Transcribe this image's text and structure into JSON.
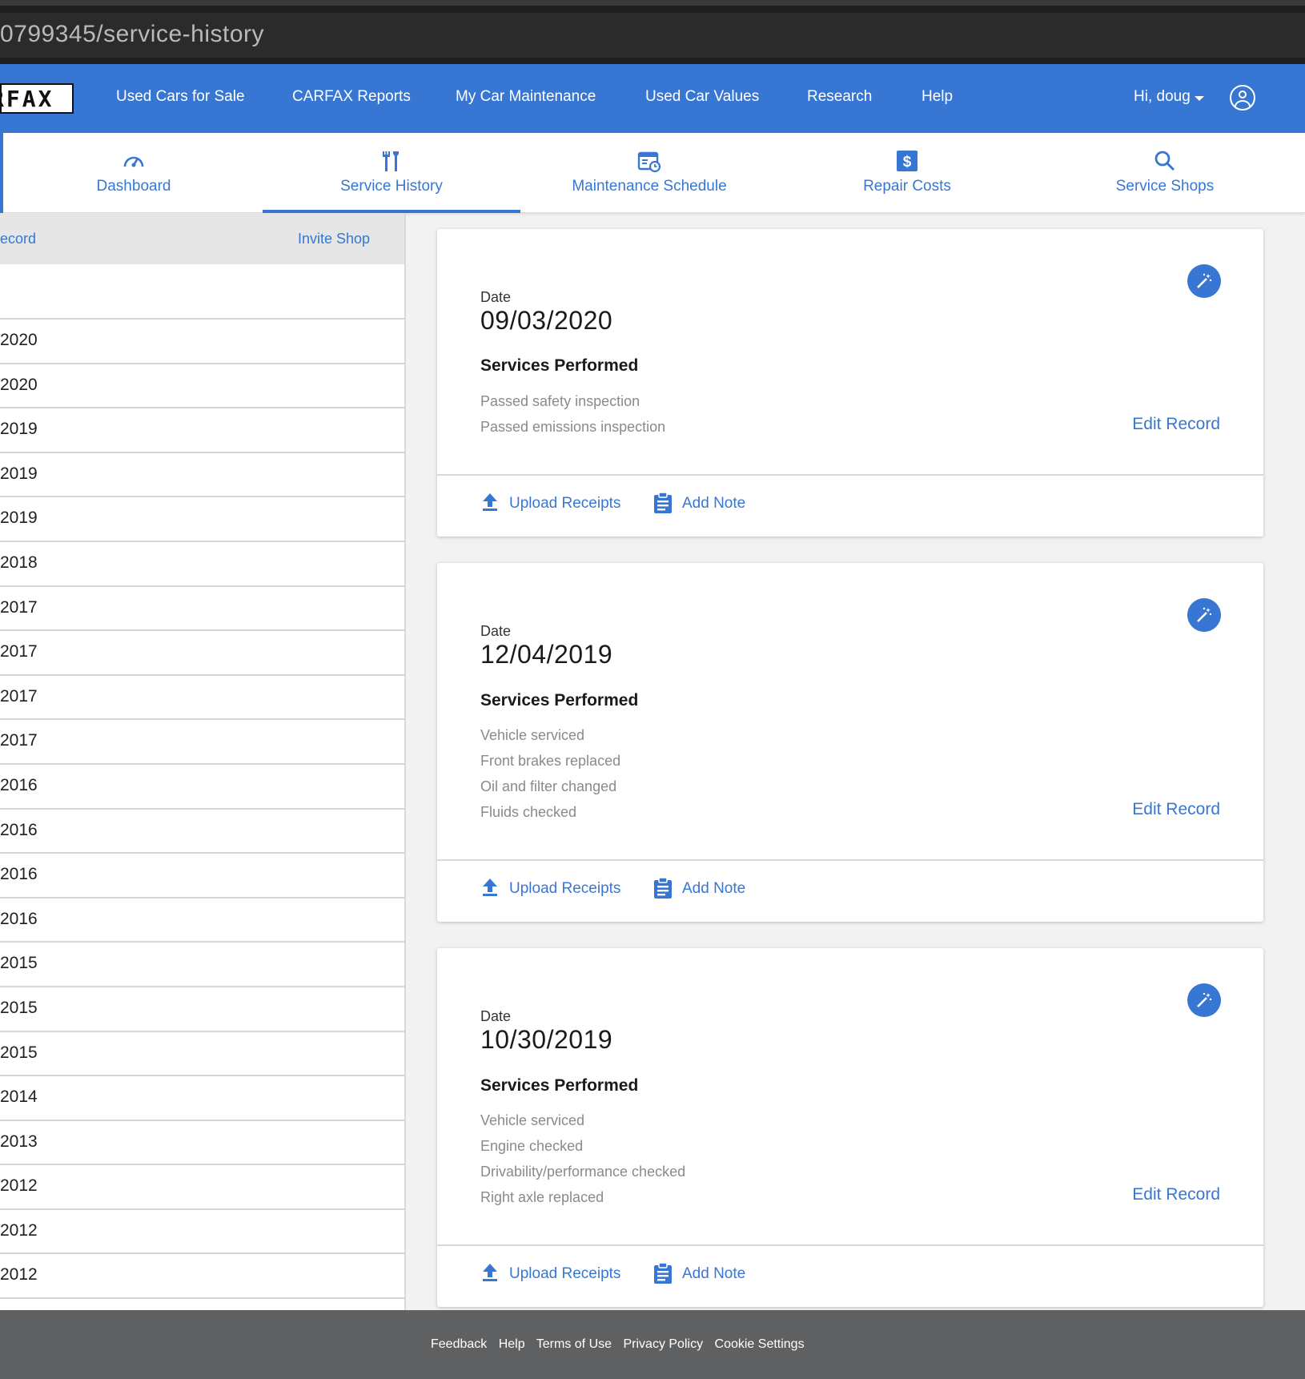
{
  "browser": {
    "url_fragment": "0799345/service-history"
  },
  "topnav": {
    "logo_text": "RFAX",
    "links": [
      "Used Cars for Sale",
      "CARFAX Reports",
      "My Car Maintenance",
      "Used Car Values",
      "Research",
      "Help"
    ],
    "user_greeting": "Hi, doug"
  },
  "subnav": {
    "tabs": [
      {
        "label": "Dashboard",
        "icon": "speedometer-icon"
      },
      {
        "label": "Service History",
        "icon": "tools-icon",
        "active": true
      },
      {
        "label": "Maintenance Schedule",
        "icon": "calendar-clock-icon"
      },
      {
        "label": "Repair Costs",
        "icon": "dollar-icon"
      },
      {
        "label": "Service Shops",
        "icon": "search-icon"
      }
    ]
  },
  "left_panel": {
    "add_record_partial": "ecord",
    "invite_shop": "Invite Shop",
    "rows": [
      "2020",
      "2020",
      "2019",
      "2019",
      "2019",
      "2018",
      "2017",
      "2017",
      "2017",
      "2017",
      "2016",
      "2016",
      "2016",
      "2016",
      "2015",
      "2015",
      "2015",
      "2014",
      "2013",
      "2012",
      "2012",
      "2012"
    ]
  },
  "records": [
    {
      "date_label": "Date",
      "date": "09/03/2020",
      "services_title": "Services Performed",
      "services": [
        "Passed safety inspection",
        "Passed emissions inspection"
      ],
      "edit_label": "Edit Record",
      "upload_label": "Upload Receipts",
      "note_label": "Add Note"
    },
    {
      "date_label": "Date",
      "date": "12/04/2019",
      "services_title": "Services Performed",
      "services": [
        "Vehicle serviced",
        "Front brakes replaced",
        "Oil and filter changed",
        "Fluids checked"
      ],
      "edit_label": "Edit Record",
      "upload_label": "Upload Receipts",
      "note_label": "Add Note"
    },
    {
      "date_label": "Date",
      "date": "10/30/2019",
      "services_title": "Services Performed",
      "services": [
        "Vehicle serviced",
        "Engine checked",
        "Drivability/performance checked",
        "Right axle replaced"
      ],
      "edit_label": "Edit Record",
      "upload_label": "Upload Receipts",
      "note_label": "Add Note"
    }
  ],
  "footer": {
    "links": [
      "Feedback",
      "Help",
      "Terms of Use",
      "Privacy Policy",
      "Cookie Settings"
    ]
  },
  "colors": {
    "brand_blue": "#3777d3",
    "footer_gray": "#5f6062",
    "text_muted": "#8a8a8a"
  }
}
